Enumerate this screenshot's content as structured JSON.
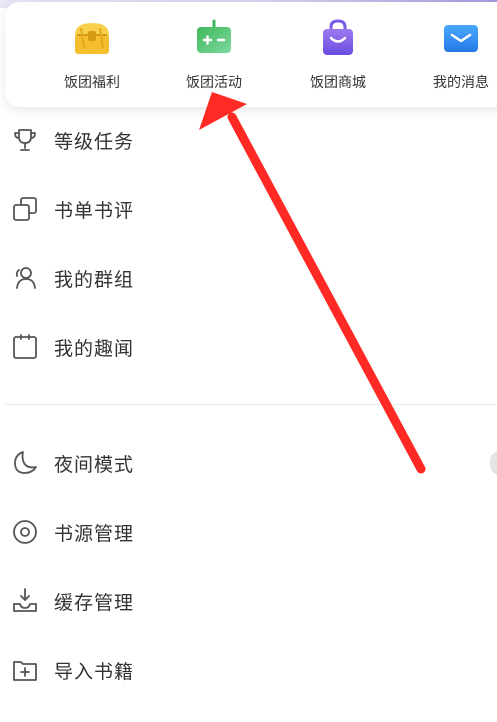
{
  "quick_actions": [
    {
      "label": "饭团福利",
      "icon": "treasure-chest-icon"
    },
    {
      "label": "饭团活动",
      "icon": "gamepad-icon"
    },
    {
      "label": "饭团商城",
      "icon": "shopping-bag-icon"
    },
    {
      "label": "我的消息",
      "icon": "mail-icon"
    }
  ],
  "menu_group_1": [
    {
      "label": "等级任务",
      "icon": "trophy-icon"
    },
    {
      "label": "书单书评",
      "icon": "copy-squares-icon"
    },
    {
      "label": "我的群组",
      "icon": "group-icon"
    },
    {
      "label": "我的趣闻",
      "icon": "clipboard-icon"
    }
  ],
  "menu_group_2": [
    {
      "label": "夜间模式",
      "icon": "moon-icon"
    },
    {
      "label": "书源管理",
      "icon": "disc-icon"
    },
    {
      "label": "缓存管理",
      "icon": "download-tray-icon"
    },
    {
      "label": "导入书籍",
      "icon": "folder-plus-icon"
    }
  ],
  "colors": {
    "arrow": "#ff2a24",
    "text": "#333333",
    "icon_stroke": "#555555",
    "chest": "#f5be2e",
    "gamepad": "#4fc36a",
    "bag": "#7b5ce8",
    "mail": "#2e8ff0"
  }
}
